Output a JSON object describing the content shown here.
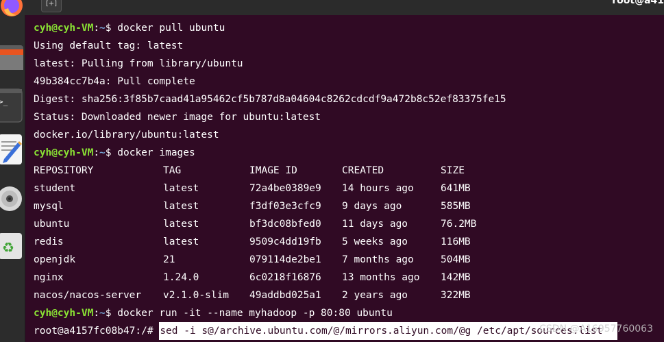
{
  "header": {
    "title": "root@a41",
    "new_tab_label": "[+]"
  },
  "dock": [
    {
      "name": "Firefox",
      "icon": "firefox-icon"
    },
    {
      "name": "Files",
      "icon": "folder-icon"
    },
    {
      "name": "Terminal",
      "icon": "terminal-icon"
    },
    {
      "name": "Text Editor",
      "icon": "text-editor-icon"
    },
    {
      "name": "Disc",
      "icon": "disc-icon"
    },
    {
      "name": "Trash",
      "icon": "recycle-icon"
    }
  ],
  "prompt": {
    "user": "cyh@cyh-VM",
    "sep": ":",
    "path": "~",
    "symbol": "$ "
  },
  "terminal": {
    "cmd1": "docker pull ubuntu",
    "out1": [
      "Using default tag: latest",
      "latest: Pulling from library/ubuntu",
      "49b384cc7b4a: Pull complete",
      "Digest: sha256:3f85b7caad41a95462cf5b787d8a04604c8262cdcdf9a472b8c52ef83375fe15",
      "Status: Downloaded newer image for ubuntu:latest",
      "docker.io/library/ubuntu:latest"
    ],
    "cmd2": "docker images",
    "images_header": [
      "REPOSITORY",
      "TAG",
      "IMAGE ID",
      "CREATED",
      "SIZE"
    ],
    "images": [
      [
        "student",
        "latest",
        "72a4be0389e9",
        "14 hours ago",
        "641MB"
      ],
      [
        "mysql",
        "latest",
        "f3df03e3cfc9",
        "9 days ago",
        "585MB"
      ],
      [
        "ubuntu",
        "latest",
        "bf3dc08bfed0",
        "11 days ago",
        "76.2MB"
      ],
      [
        "redis",
        "latest",
        "9509c4dd19fb",
        "5 weeks ago",
        "116MB"
      ],
      [
        "openjdk",
        "21",
        "079114de2be1",
        "7 months ago",
        "504MB"
      ],
      [
        "nginx",
        "1.24.0",
        "6c0218f16876",
        "13 months ago",
        "142MB"
      ],
      [
        "nacos/nacos-server",
        "v2.1.0-slim",
        "49addbd025a1",
        "2 years ago",
        "322MB"
      ]
    ],
    "cmd3": "docker run -it --name myhadoop -p 80:80 ubuntu",
    "root_prompt": "root@a4157fc08b47:/# ",
    "root_cmd": "sed -i s@/archive.ubuntu.com/@/mirrors.aliyun.com/@g /etc/apt/sources.list"
  },
  "watermark": "CSDN @A16957760063",
  "colors": {
    "background": "#300a24",
    "prompt_user": "#8ae234",
    "prompt_path": "#729fcf"
  }
}
